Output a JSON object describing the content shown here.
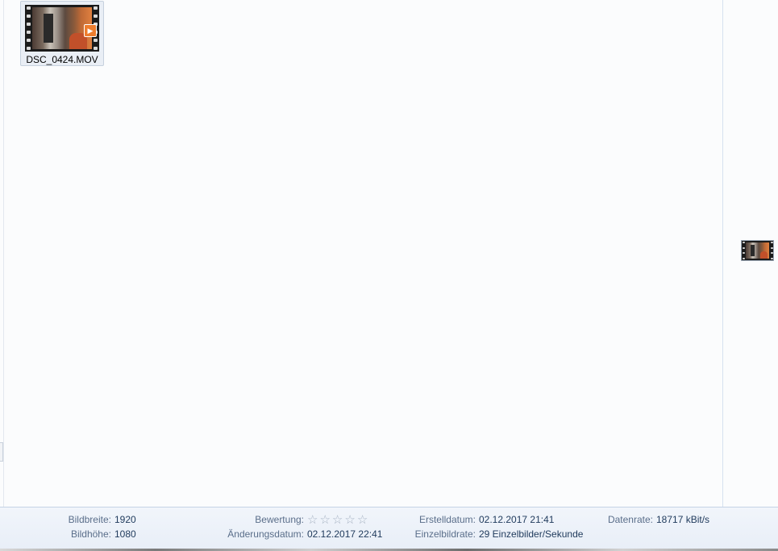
{
  "files": [
    {
      "name": "DSC_0424.MOV",
      "icon": "video-file-thumbnail",
      "badge": "play-icon"
    }
  ],
  "preview": {
    "icon": "video-preview-thumbnail"
  },
  "details": {
    "width_label": "Bildbreite:",
    "width_value": "1920",
    "height_label": "Bildhöhe:",
    "height_value": "1080",
    "rating_label": "Bewertung:",
    "rating_stars": 0,
    "rating_max": 5,
    "modified_label": "Änderungsdatum:",
    "modified_value": "02.12.2017 22:41",
    "created_label": "Erstelldatum:",
    "created_value": "02.12.2017 21:41",
    "framerate_label": "Einzelbildrate:",
    "framerate_value": "29 Einzelbilder/Sekunde",
    "datarate_label": "Datenrate:",
    "datarate_value": "18717 kBit/s"
  },
  "colors": {
    "accent": "#ee7d2e",
    "label": "#5a6e8a",
    "value": "#1e395b",
    "selection": "#e9eef5"
  }
}
